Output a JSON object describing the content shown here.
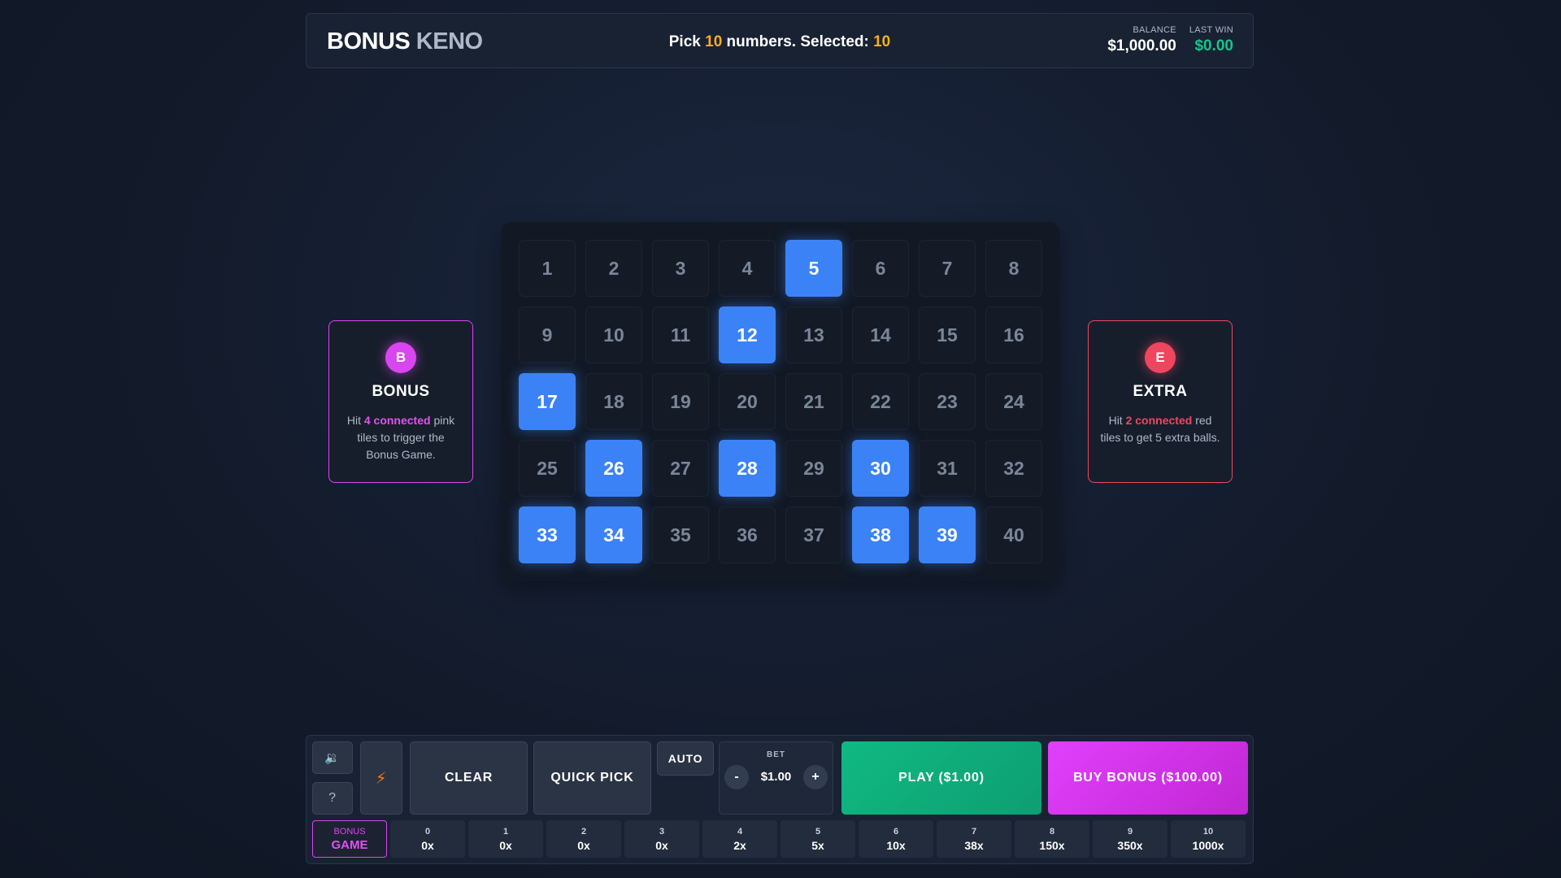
{
  "header": {
    "title_main": "BONUS",
    "title_sub": "KENO",
    "pick_prefix": "Pick",
    "pick_count": "10",
    "pick_mid": "numbers. Selected:",
    "selected_count": "10",
    "balance_label": "BALANCE",
    "balance_value": "$1,000.00",
    "lastwin_label": "LAST WIN",
    "lastwin_value": "$0.00"
  },
  "bonus_panel": {
    "badge": "B",
    "title": "BONUS",
    "desc_pre": "Hit",
    "desc_hl": "4 connected",
    "desc_post": "pink tiles to trigger the Bonus Game."
  },
  "extra_panel": {
    "badge": "E",
    "title": "EXTRA",
    "desc_pre": "Hit",
    "desc_hl": "2 connected",
    "desc_post": "red tiles to get 5 extra balls."
  },
  "grid": {
    "numbers": [
      "1",
      "2",
      "3",
      "4",
      "5",
      "6",
      "7",
      "8",
      "9",
      "10",
      "11",
      "12",
      "13",
      "14",
      "15",
      "16",
      "17",
      "18",
      "19",
      "20",
      "21",
      "22",
      "23",
      "24",
      "25",
      "26",
      "27",
      "28",
      "29",
      "30",
      "31",
      "32",
      "33",
      "34",
      "35",
      "36",
      "37",
      "38",
      "39",
      "40"
    ],
    "selected": [
      "5",
      "12",
      "17",
      "26",
      "28",
      "30",
      "33",
      "34",
      "38",
      "39"
    ]
  },
  "controls": {
    "sound_icon": "speaker-icon",
    "help_label": "?",
    "turbo_icon": "lightning-icon",
    "clear_label": "CLEAR",
    "quickpick_label": "QUICK PICK",
    "auto_label": "AUTO",
    "bet_label": "BET",
    "bet_value": "$1.00",
    "minus_label": "-",
    "plus_label": "+",
    "play_label": "PLAY ($1.00)",
    "buy_bonus_label": "BUY BONUS ($100.00)"
  },
  "paytable": {
    "bonus_hits": "BONUS",
    "bonus_mult": "GAME",
    "rows": [
      {
        "hits": "0",
        "mult": "0x"
      },
      {
        "hits": "1",
        "mult": "0x"
      },
      {
        "hits": "2",
        "mult": "0x"
      },
      {
        "hits": "3",
        "mult": "0x"
      },
      {
        "hits": "4",
        "mult": "2x"
      },
      {
        "hits": "5",
        "mult": "5x"
      },
      {
        "hits": "6",
        "mult": "10x"
      },
      {
        "hits": "7",
        "mult": "38x"
      },
      {
        "hits": "8",
        "mult": "150x"
      },
      {
        "hits": "9",
        "mult": "350x"
      },
      {
        "hits": "10",
        "mult": "1000x"
      }
    ]
  },
  "colors": {
    "selected_tile": "#3b82f6",
    "bonus_accent": "#d946ef",
    "extra_accent": "#f0455f",
    "play_green": "#10b981",
    "highlight_yellow": "#f5b020"
  }
}
